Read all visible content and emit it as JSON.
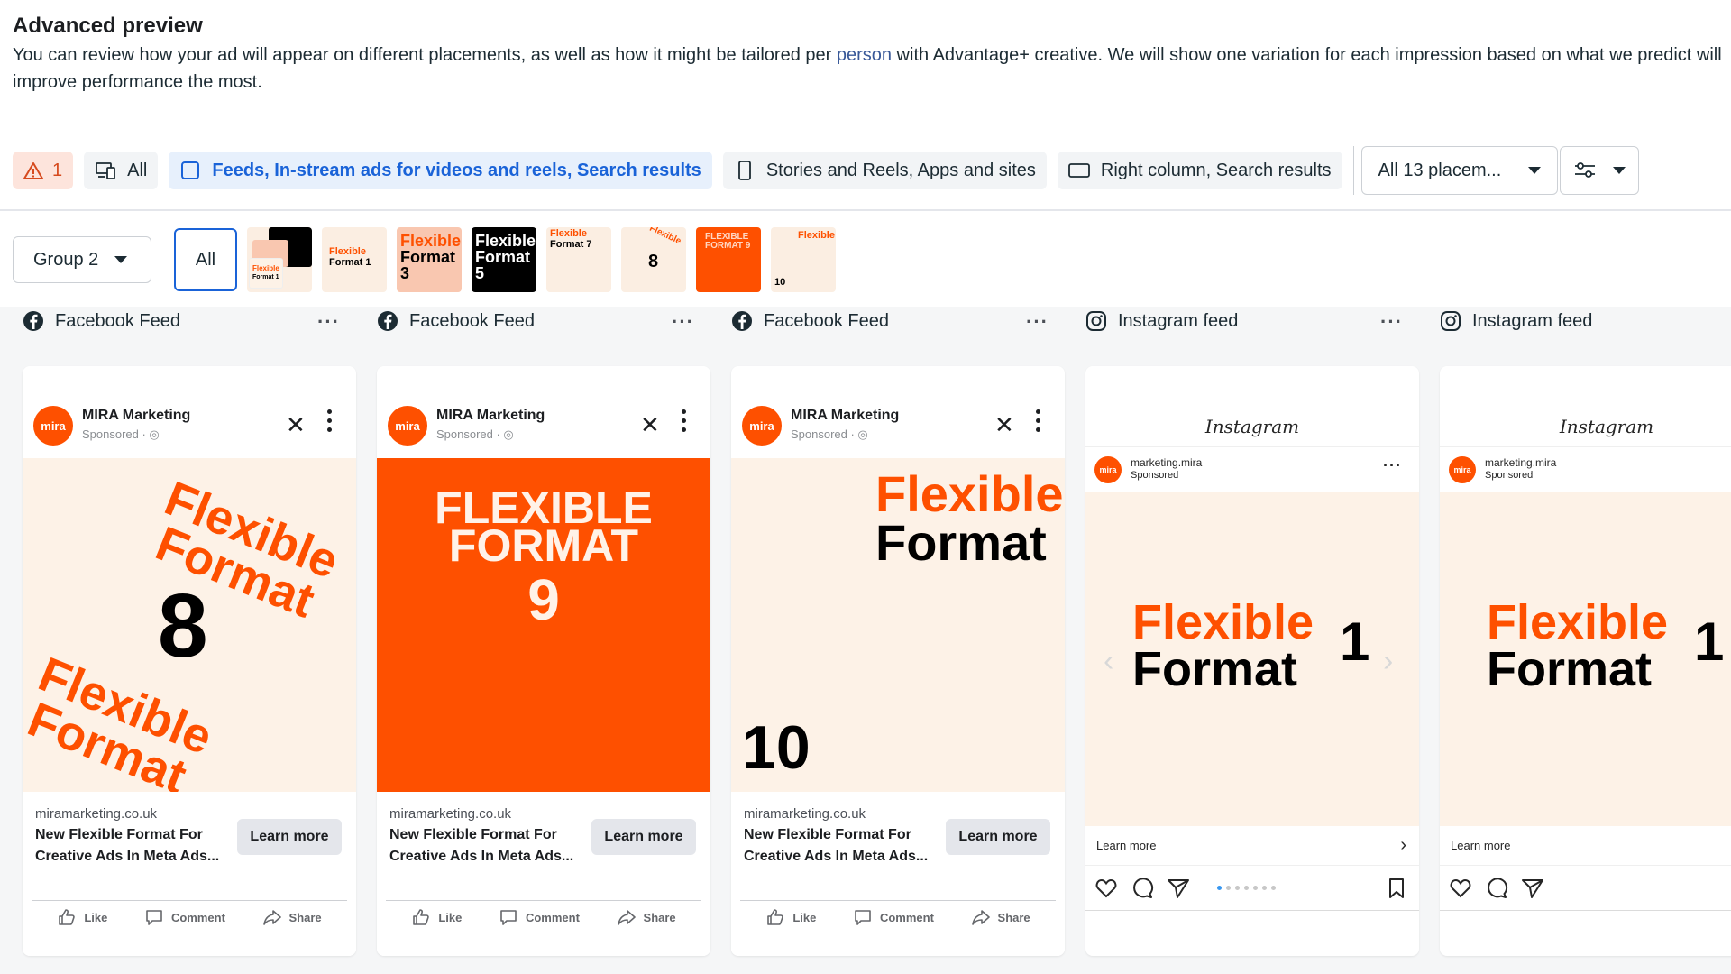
{
  "header": {
    "title": "Advanced preview",
    "desc_before": "You can review how your ad will appear on different placements, as well as how it might be tailored per ",
    "desc_link": "person",
    "desc_after": " with Advantage+ creative. We will show one variation for each impression based on what we predict will improve performance the most."
  },
  "filters": {
    "warning_count": "1",
    "all_label": "All",
    "feeds_label": "Feeds, In-stream ads for videos and reels, Search results",
    "stories_label": "Stories and Reels, Apps and sites",
    "right_label": "Right column, Search results",
    "placements_select": "All 13 placem..."
  },
  "creatives": {
    "group_label": "Group 2",
    "all_label": "All",
    "thumbs": [
      {
        "top": "Flexible",
        "bottom": "Format 1"
      },
      {
        "top": "Flexible",
        "bottom": "Format 1"
      },
      {
        "top": "Flexible",
        "bottom": "Format 3"
      },
      {
        "top": "Flexible",
        "bottom": "Format 5"
      },
      {
        "top": "Flexible",
        "bottom": "Format 7"
      },
      {
        "top": "Flexible",
        "bottom": "8"
      },
      {
        "top": "FLEXIBLE",
        "bottom": "FORMAT 9"
      },
      {
        "top": "Flexible",
        "bottom": "10"
      }
    ]
  },
  "previews": [
    {
      "placement": "Facebook Feed",
      "brand": "MIRA Marketing",
      "sponsored": "Sponsored · ◎",
      "avatar": "mira",
      "domain": "miramarketing.co.uk",
      "headline": "New Flexible Format For Creative Ads In Meta Ads...",
      "cta": "Learn more",
      "word1": "Flexible",
      "word2": "Format",
      "number": "8",
      "like": "Like",
      "comment": "Comment",
      "share": "Share"
    },
    {
      "placement": "Facebook Feed",
      "brand": "MIRA Marketing",
      "sponsored": "Sponsored · ◎",
      "avatar": "mira",
      "domain": "miramarketing.co.uk",
      "headline": "New Flexible Format For Creative Ads In Meta Ads...",
      "cta": "Learn more",
      "word1": "FLEXIBLE",
      "word2": "FORMAT",
      "number": "9",
      "like": "Like",
      "comment": "Comment",
      "share": "Share"
    },
    {
      "placement": "Facebook Feed",
      "brand": "MIRA Marketing",
      "sponsored": "Sponsored · ◎",
      "avatar": "mira",
      "domain": "miramarketing.co.uk",
      "headline": "New Flexible Format For Creative Ads In Meta Ads...",
      "cta": "Learn more",
      "word1": "Flexible",
      "word2": "Format",
      "number": "10",
      "like": "Like",
      "comment": "Comment",
      "share": "Share"
    },
    {
      "placement": "Instagram feed",
      "logo": "Instagram",
      "account": "marketing.mira",
      "sponsored": "Sponsored",
      "avatar": "mira",
      "word1": "Flexible",
      "word2": "Format",
      "number": "1",
      "cta": "Learn more"
    },
    {
      "placement": "Instagram feed",
      "logo": "Instagram",
      "account": "marketing.mira",
      "sponsored": "Sponsored",
      "avatar": "mira",
      "word1": "Flexible",
      "word2": "Format",
      "number": "1",
      "cta": "Learn more"
    }
  ],
  "colors": {
    "brand_orange": "#fe5000",
    "cream": "#fdf2e7",
    "link_blue": "#1a63d8",
    "warning": "#d64a1e"
  }
}
